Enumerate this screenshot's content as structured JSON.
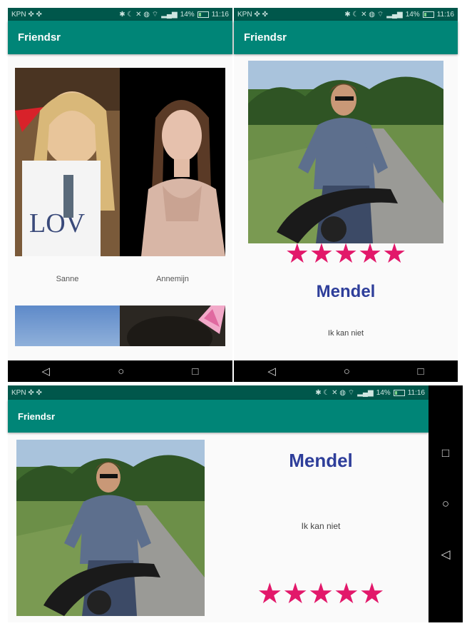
{
  "status_bar": {
    "carrier": "KPN ✜ ✜",
    "icons": "✱ ☾ ✕ ◍ ⌔",
    "signal": "▂▄▆",
    "battery": "14%",
    "time": "11:16"
  },
  "app": {
    "title": "Friendsr"
  },
  "grid": {
    "friends": [
      {
        "name": "Sanne"
      },
      {
        "name": "Annemijn"
      }
    ]
  },
  "profile": {
    "name": "Mendel",
    "bio": "Ik kan niet",
    "rating": 5,
    "rating_max": 5,
    "star_glyph": "★"
  },
  "nav": {
    "back_glyph": "◁",
    "home_glyph": "○",
    "recents_glyph": "□"
  },
  "colors": {
    "primary": "#008577",
    "primary_dark": "#00574B",
    "name_text": "#2E3E9A",
    "star": "#E2186A"
  }
}
